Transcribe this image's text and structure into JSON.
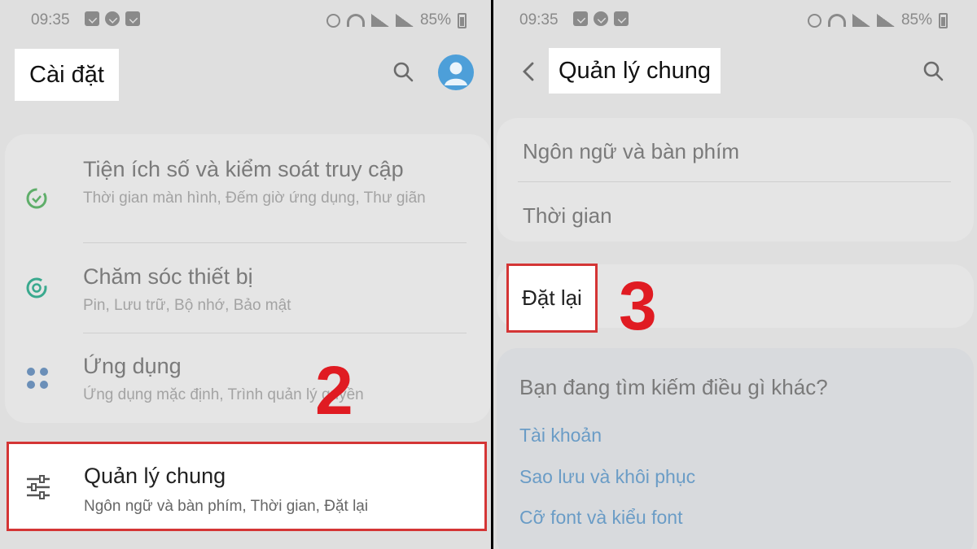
{
  "left": {
    "status": {
      "time": "09:35",
      "battery": "85%"
    },
    "title": "Cài đặt",
    "items": [
      {
        "label": "Tiện ích số và kiểm soát truy cập",
        "sub": "Thời gian màn hình, Đếm giờ ứng dụng, Thư giãn",
        "icon": "digital-wellbeing-icon",
        "color": "#5fae6a"
      },
      {
        "label": "Chăm sóc thiết bị",
        "sub": "Pin, Lưu trữ, Bộ nhớ, Bảo mật",
        "icon": "device-care-icon",
        "color": "#3aa98e"
      },
      {
        "label": "Ứng dụng",
        "sub": "Ứng dụng mặc định, Trình quản lý quyền",
        "icon": "apps-icon",
        "color": "#6b8fb8"
      }
    ],
    "highlight": {
      "label": "Quản lý chung",
      "sub": "Ngôn ngữ và bàn phím, Thời gian, Đặt lại",
      "icon": "general-management-icon"
    },
    "step": "2"
  },
  "right": {
    "status": {
      "time": "09:35",
      "battery": "85%"
    },
    "title": "Quản lý chung",
    "items": [
      "Ngôn ngữ và bàn phím",
      "Thời gian"
    ],
    "reset": "Đặt lại",
    "step": "3",
    "looking_for": "Bạn đang tìm kiếm điều gì khác?",
    "links": [
      "Tài khoản",
      "Sao lưu và khôi phục",
      "Cỡ font và kiểu font"
    ]
  },
  "colors": {
    "highlight_border": "#d43535",
    "step_number": "#e01b22",
    "avatar": "#4d9fd9",
    "link": "#6a9cc6"
  }
}
